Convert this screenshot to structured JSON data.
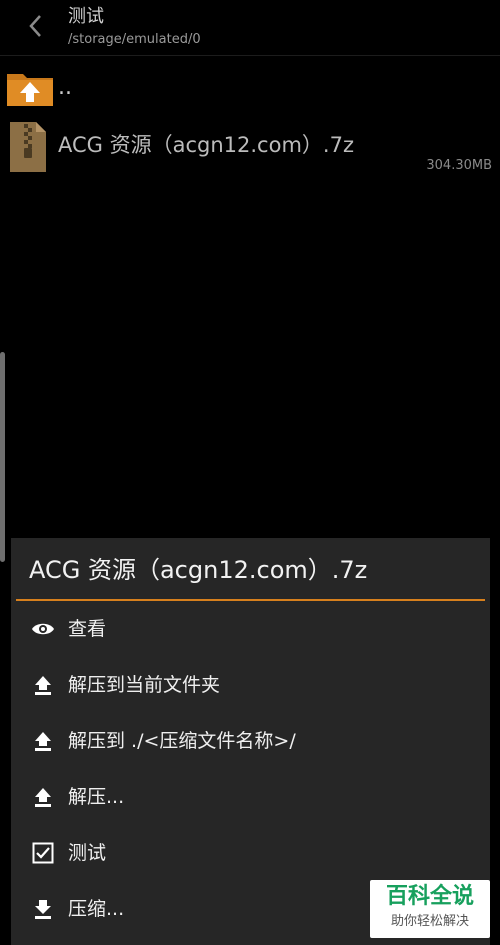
{
  "header": {
    "title": "测试",
    "path": "/storage/emulated/0"
  },
  "files": {
    "up_label": "..",
    "item": {
      "name": "ACG 资源（acgn12.com）.7z",
      "size": "304.30MB"
    }
  },
  "sheet": {
    "title": "ACG 资源（acgn12.com）.7z",
    "accent_color": "#d7801d",
    "items": [
      {
        "label": "查看",
        "icon": "eye-icon"
      },
      {
        "label": "解压到当前文件夹",
        "icon": "upload-icon"
      },
      {
        "label": "解压到 ./<压缩文件名称>/",
        "icon": "upload-icon"
      },
      {
        "label": "解压...",
        "icon": "upload-icon"
      },
      {
        "label": "测试",
        "icon": "checkbox-icon"
      },
      {
        "label": "压缩...",
        "icon": "download-icon"
      }
    ]
  },
  "watermark": {
    "main": "百科全说",
    "sub": "助你轻松解决"
  }
}
